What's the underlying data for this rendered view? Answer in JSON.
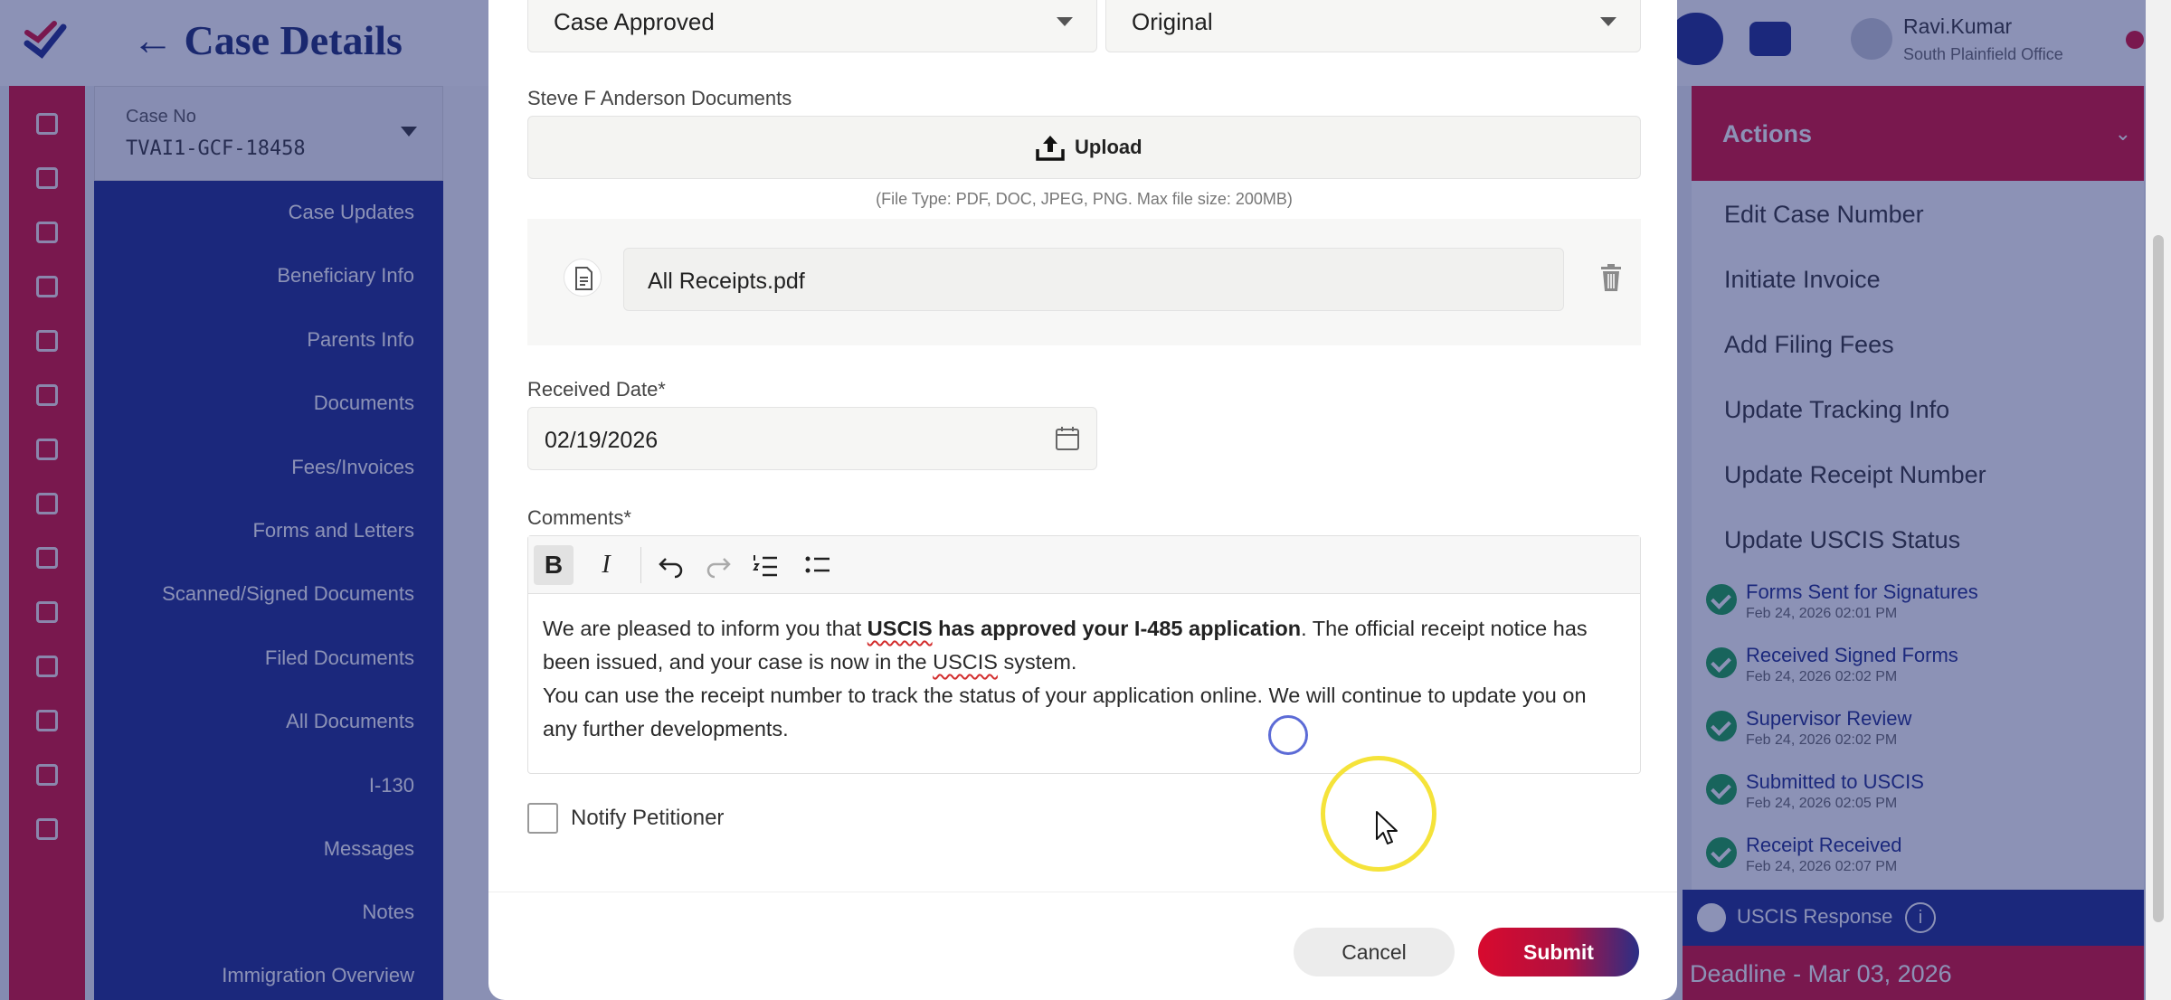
{
  "app": {
    "page_title": "Case Details",
    "case_no_label": "Case No",
    "case_no_value": "TVAI1-GCF-18458",
    "user_name": "Ravi.Kumar",
    "user_office": "South Plainfield Office",
    "nav": [
      "Case Updates",
      "Beneficiary Info",
      "Parents Info",
      "Documents",
      "Fees/Invoices",
      "Forms and Letters",
      "Scanned/Signed Documents",
      "Filed Documents",
      "All Documents",
      "I-130",
      "Messages",
      "Notes",
      "Immigration Overview"
    ],
    "actions_title": "Actions",
    "actions": [
      "Edit Case Number",
      "Initiate Invoice",
      "Add Filing Fees",
      "Update Tracking Info",
      "Update Receipt Number",
      "Update USCIS Status"
    ],
    "timeline": [
      {
        "title": "Forms Sent for Signatures",
        "date": "Feb 24, 2026 02:01 PM"
      },
      {
        "title": "Received Signed Forms",
        "date": "Feb 24, 2026 02:02 PM"
      },
      {
        "title": "Supervisor Review",
        "date": "Feb 24, 2026 02:02 PM"
      },
      {
        "title": "Submitted to USCIS",
        "date": "Feb 24, 2026 02:05 PM"
      },
      {
        "title": "Receipt Received",
        "date": "Feb 24, 2026 02:07 PM"
      }
    ],
    "uscis_response": "USCIS Response",
    "info_glyph": "i",
    "deadline": "Deadline - Mar 03, 2026"
  },
  "modal": {
    "status_value": "Case Approved",
    "document_type_value": "Original",
    "documents_label": "Steve F Anderson Documents",
    "upload_label": "Upload",
    "file_types_hint": "(File Type: PDF, DOC, JPEG, PNG. Max file size: 200MB)",
    "uploaded_file": "All Receipts.pdf",
    "received_date_label": "Received Date*",
    "received_date_value": "02/19/2026",
    "comments_label": "Comments*",
    "toolbar": {
      "bold": "B",
      "italic": "I"
    },
    "comment": {
      "p1_a": "We are pleased to inform you that ",
      "p1_b1": "USCIS",
      "p1_b2": " has approved your I-485 application",
      "p1_c": ". The official receipt notice has been issued, and your case is now in the ",
      "p1_d": "USCIS",
      "p1_e": " system.",
      "p2": "You can use the receipt number to track the status of your application online. We will continue to update you on any further developments."
    },
    "notify_label": "Notify Petitioner",
    "notify_checked": false,
    "cancel_label": "Cancel",
    "submit_label": "Submit"
  },
  "colors": {
    "brand_red": "#d80a2e",
    "brand_navy": "#1c2a8a",
    "success": "#16a34a"
  }
}
